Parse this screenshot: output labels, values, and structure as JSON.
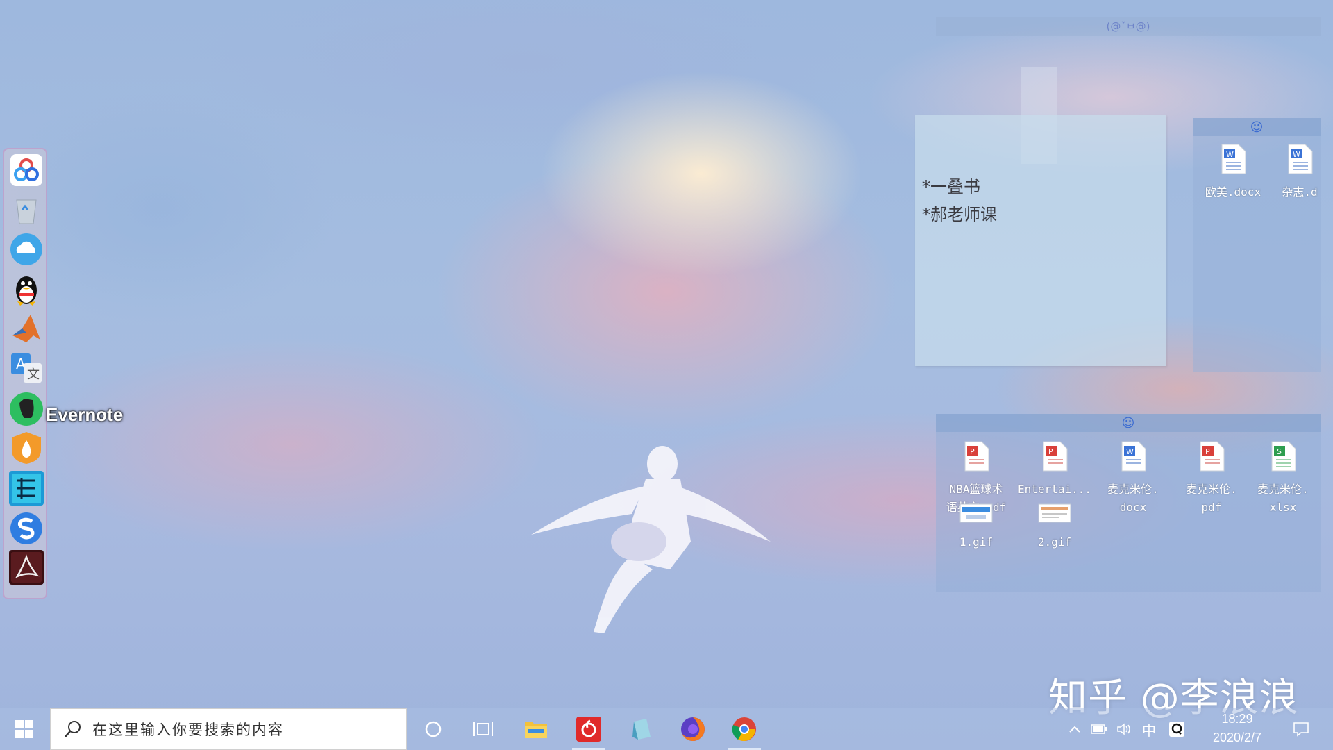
{
  "dock": {
    "items": [
      {
        "name": "baidu-netdisk-icon"
      },
      {
        "name": "recycle-bin-icon"
      },
      {
        "name": "cloud-icon"
      },
      {
        "name": "qq-icon"
      },
      {
        "name": "matlab-icon"
      },
      {
        "name": "translate-icon"
      },
      {
        "name": "evernote-icon"
      },
      {
        "name": "flame-app-icon"
      },
      {
        "name": "mindmap-icon"
      },
      {
        "name": "sogou-browser-icon"
      },
      {
        "name": "acrobat-icon"
      }
    ],
    "tooltip": "Evernote"
  },
  "top_fence": {
    "face": "(@ˇㅂ@)"
  },
  "sticky_note": {
    "lines": [
      "*一叠书",
      "*郝老师课"
    ]
  },
  "fence_right": {
    "files": [
      {
        "label": "欧美.docx",
        "type": "word"
      },
      {
        "label": "杂志.d",
        "type": "word"
      }
    ]
  },
  "fence_bottom": {
    "files": [
      {
        "label": "NBA篮球术\n语英文.pdf",
        "type": "pdf"
      },
      {
        "label": "Entertai...",
        "type": "pdf"
      },
      {
        "label": "麦克米伦.\ndocx",
        "type": "word"
      },
      {
        "label": "麦克米伦.\npdf",
        "type": "pdf"
      },
      {
        "label": "麦克米伦.\nxlsx",
        "type": "excel"
      },
      {
        "label": "1.gif",
        "type": "image"
      },
      {
        "label": "2.gif",
        "type": "image"
      }
    ]
  },
  "taskbar": {
    "search_placeholder": "在这里输入你要搜索的内容",
    "apps": [
      "file-explorer-icon",
      "netease-music-icon",
      "notepad-icon",
      "firefox-icon",
      "chrome-icon"
    ],
    "ime": "中",
    "clock": {
      "time": "18:29",
      "date": "2020/2/7"
    }
  },
  "watermark": "知乎 @李浪浪",
  "colors": {
    "accent": "#3a6ad1",
    "pdf_red": "#d9403a",
    "word_blue": "#3b73d6",
    "excel_green": "#2e9e4f"
  }
}
